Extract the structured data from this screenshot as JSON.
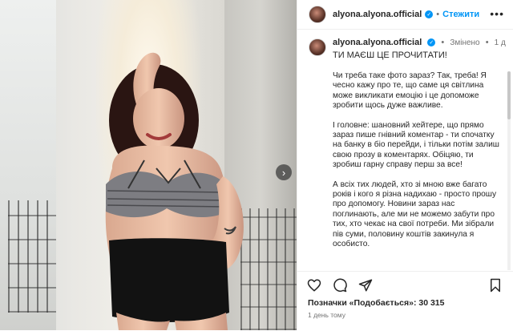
{
  "post": {
    "username": "alyona.alyona.official",
    "follow_label": "Стежити",
    "more_label": "•••"
  },
  "caption": {
    "username": "alyona.alyona.official",
    "edited_label": "Змінено",
    "age": "1 д",
    "title": "ТИ МАЄШ ЦЕ ПРОЧИТАТИ!",
    "paragraphs": [
      "Чи треба таке фото зараз? Так, треба! Я чесно кажу про те, що саме ця світлина може викликати емоцію і це допоможе зробити щось дуже важливе.",
      "І головне: шановний хейтере, що прямо зараз пише гнівний коментар - ти спочатку на банку в біо перейди, і тільки потім залиш свою прозу в коментарях. Обіцяю, ти зробиш гарну справу перш за все!",
      "А всіх тих людей, хто зі мною вже багато років і кого я різна надихаю - просто прошу про допомогу. Новини зараз нас поглинають, але ми не можемо забути про тих, хто чекає на свої потреби. Ми зібрали пів суми, половину коштів закинула я особисто."
    ]
  },
  "footer": {
    "likes": "Позначки «Подобається»: 30 315",
    "time": "1 день тому"
  },
  "icons": [
    "heart-icon",
    "comment-icon",
    "share-icon",
    "bookmark-icon",
    "verified-icon",
    "next-arrow-icon"
  ],
  "colors": {
    "accent": "#0095f6",
    "text": "#262626",
    "muted": "#737373"
  }
}
